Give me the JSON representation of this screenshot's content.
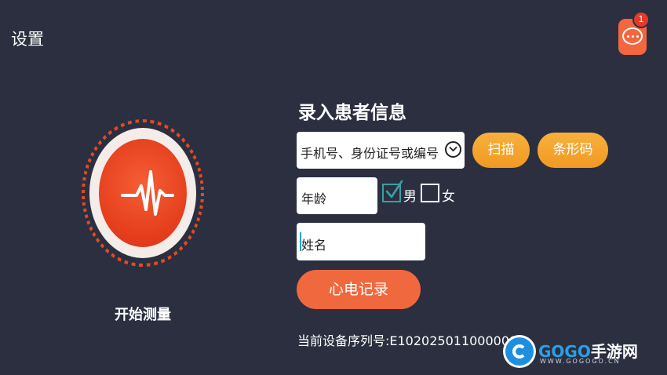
{
  "header": {
    "settings_label": "设置",
    "message_badge_count": "1"
  },
  "measure": {
    "label": "开始测量"
  },
  "form": {
    "title": "录入患者信息",
    "id_placeholder": "手机号、身份证号或编号",
    "scan_label": "扫描",
    "barcode_label": "条形码",
    "age_placeholder": "年龄",
    "gender_male_label": "男",
    "gender_female_label": "女",
    "male_checked": true,
    "female_checked": false,
    "name_placeholder": "姓名",
    "ecg_record_label": "心电记录",
    "serial_text": "当前设备序列号:E102025011000000"
  },
  "watermark": {
    "brand_go": "GOGO",
    "brand_cn": "手游网",
    "url": "WWW.GOGOGO.CN"
  },
  "colors": {
    "background": "#2b2f3f",
    "accent_orange": "#f0683d",
    "button_amber": "#f5a630",
    "checkbox_teal": "#36a2a2"
  },
  "icons": {
    "message": "chat-bubble-icon",
    "measure": "heartbeat-pulse-icon",
    "dropdown": "chevron-down-icon",
    "checkbox_checked": "checkmark-icon"
  }
}
